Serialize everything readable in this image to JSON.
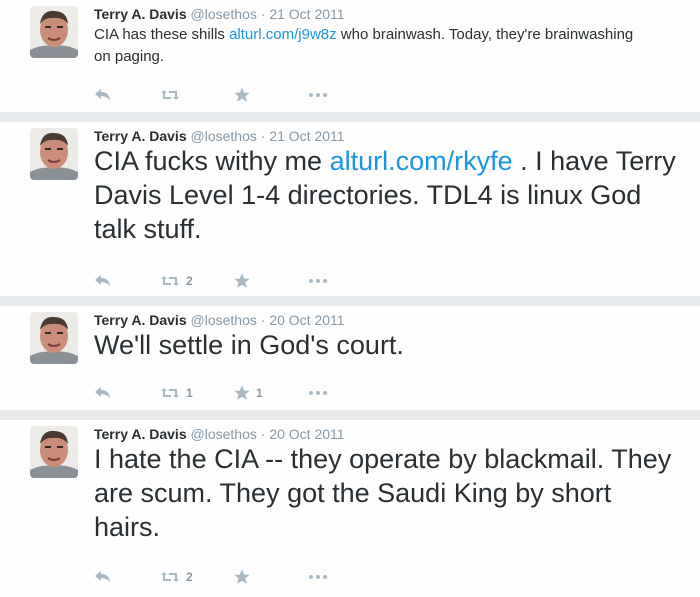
{
  "background_text": [],
  "tweets": [
    {
      "author": {
        "name": "Terry A. Davis",
        "handle": "@losethos"
      },
      "separator": "·",
      "date": "21 Oct 2011",
      "text_before": "CIA has these shills ",
      "link": "alturl.com/j9w8z",
      "text_after": " who brainwash. Today, they're brainwashing on paging.",
      "actions": {
        "reply": "",
        "retweet": "",
        "like": ""
      }
    },
    {
      "author": {
        "name": "Terry A. Davis",
        "handle": "@losethos"
      },
      "separator": "·",
      "date": "21 Oct 2011",
      "text_before": "CIA fucks withy me ",
      "link": "alturl.com/rkyfe",
      "text_after": " .  I have Terry Davis Level 1-4 directories. TDL4 is linux God talk stuff.",
      "actions": {
        "reply": "",
        "retweet": "2",
        "like": ""
      }
    },
    {
      "author": {
        "name": "Terry A. Davis",
        "handle": "@losethos"
      },
      "separator": "·",
      "date": "20 Oct 2011",
      "text_before": "We'll settle in God's court.",
      "link": "",
      "text_after": "",
      "actions": {
        "reply": "",
        "retweet": "1",
        "like": "1"
      }
    },
    {
      "author": {
        "name": "Terry A. Davis",
        "handle": "@losethos"
      },
      "separator": "·",
      "date": "20 Oct 2011",
      "text_before": "I hate the CIA -- they operate by blackmail. They are scum.  They got the Saudi King by short hairs.",
      "link": "",
      "text_after": "",
      "actions": {
        "reply": "",
        "retweet": "2",
        "like": ""
      }
    }
  ],
  "icons": {
    "reply": "reply-icon",
    "retweet": "retweet-icon",
    "like": "star-icon",
    "more": "more-icon"
  },
  "colors": {
    "name": "#292f33",
    "meta": "#8899a6",
    "link": "#1b95e0",
    "icon": "#aab8c2"
  }
}
